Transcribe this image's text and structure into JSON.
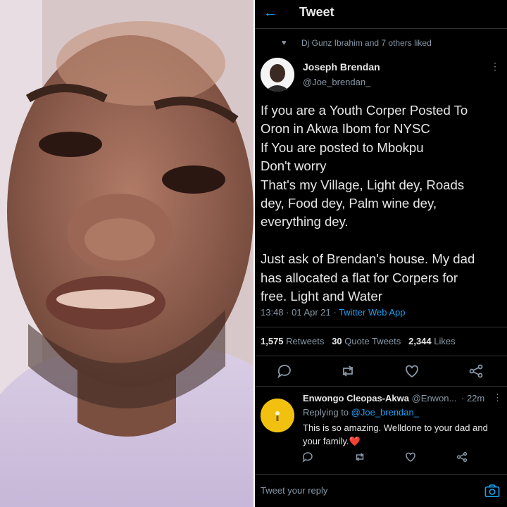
{
  "header": {
    "back_icon": "arrow-left-icon",
    "title": "Tweet"
  },
  "social_context": {
    "text": "Dj Gunz Ibrahim and 7 others liked"
  },
  "tweet": {
    "name": "Joseph Brendan",
    "handle": "@Joe_brendan_",
    "text": "If you are a Youth Corper Posted To\nOron in Akwa Ibom for NYSC\nIf You are posted to Mbokpu\nDon't worry\nThat's my Village, Light dey, Roads\ndey, Food dey, Palm wine dey,\neverything dey.\n\nJust ask of Brendan's house. My dad\nhas allocated a flat for Corpers for\nfree. Light and Water",
    "time": "13:48 · 01 Apr 21 · ",
    "source": "Twitter Web App",
    "retweets": "1,575",
    "retweets_label": " Retweets",
    "quotes": "30",
    "quotes_label": " Quote Tweets",
    "likes": "2,344",
    "likes_label": " Likes"
  },
  "reply": {
    "name": "Enwongo Cleopas-Akwa",
    "handle": " @Enwon...",
    "time": "· 22m",
    "replying_prefix": "Replying to ",
    "replying_to": "@Joe_brendan_",
    "text": "This is so amazing. Welldone to your dad and your family.❤️"
  },
  "compose": {
    "placeholder": "Tweet your reply"
  },
  "colors": {
    "accent": "#1da1f2",
    "background": "#000000",
    "muted": "#8899a6"
  }
}
